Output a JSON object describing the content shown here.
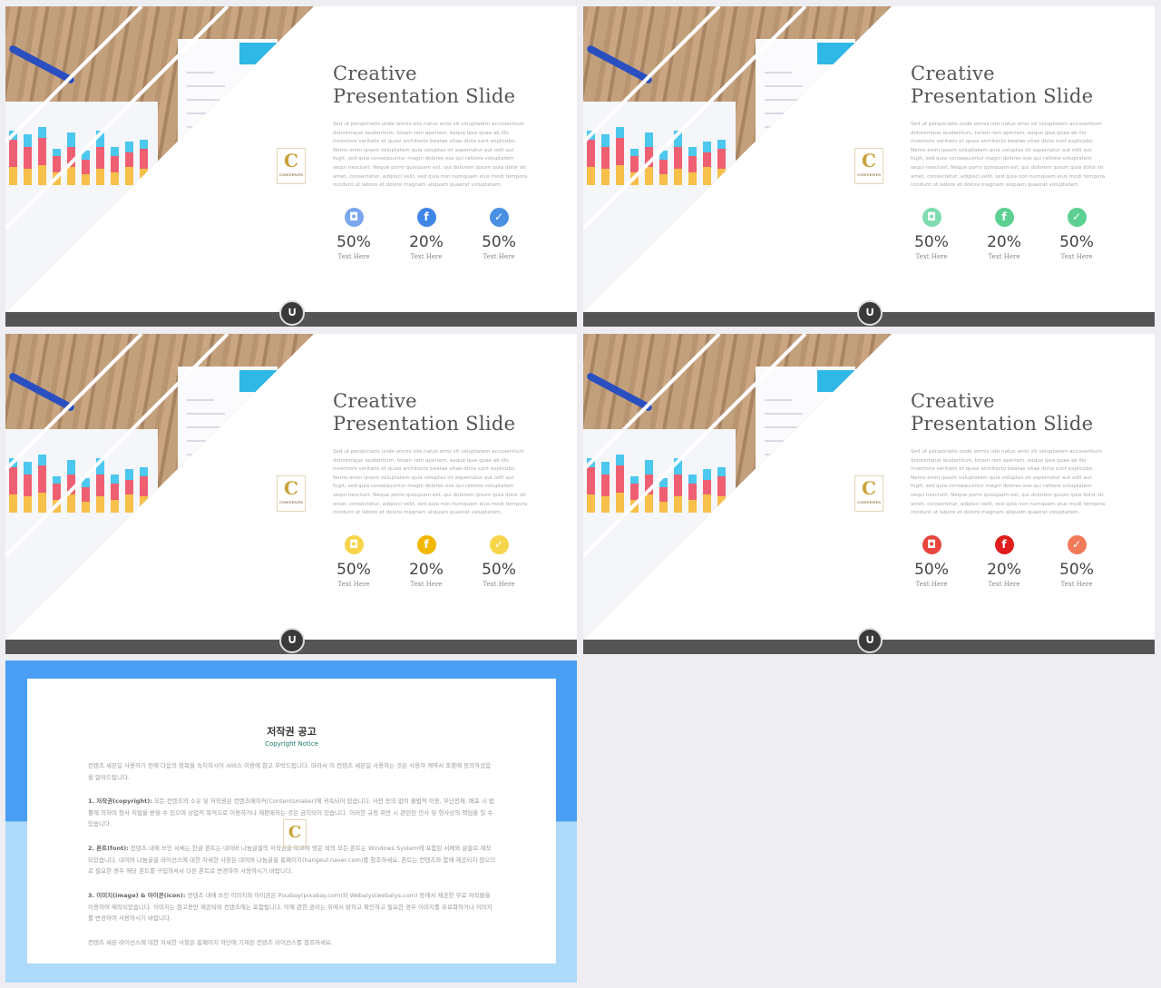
{
  "slides": [
    {
      "title_line1": "Creative",
      "title_line2": "Presentation Slide",
      "body": "Sed ut perspiciatis unde omnis iste natus error sit voluptatem accusantium doloremque laudantium, totam rem aperiam, eaque ipsa quae ab illo inventore veritatis et quasi architecto beatae vitae dicta sunt explicabo. Nemo enim ipsam voluptatem quia voluptas sit aspernatur aut odit aut fugit, sed quia consequuntur magni dolores eos qui ratione voluptatem sequi nesciunt. Neque porro quisquam est, qui dolorem ipsum quia dolor sit amet, consectetur, adipisci velit, sed quia non numquam eius modi tempora incidunt ut labore et dolore magnam aliquam quaerat voluptatem.",
      "logo": "C",
      "logo_sub": "CONTENTS",
      "stats": [
        {
          "icon": "instagram-icon",
          "value": "50%",
          "label": "Text  Here",
          "color": "#7aa6ee"
        },
        {
          "icon": "facebook-icon",
          "value": "20%",
          "label": "Text  Here",
          "color": "#3f86e6"
        },
        {
          "icon": "twitter-icon",
          "value": "50%",
          "label": "Text  Here",
          "color": "#4a90e2"
        }
      ]
    },
    {
      "title_line1": "Creative",
      "title_line2": "Presentation Slide",
      "body": "Sed ut perspiciatis unde omnis iste natus error sit voluptatem accusantium doloremque laudantium, totam rem aperiam, eaque ipsa quae ab illo inventore veritatis et quasi architecto beatae vitae dicta sunt explicabo. Nemo enim ipsam voluptatem quia voluptas sit aspernatur aut odit aut fugit, sed quia consequuntur magni dolores eos qui ratione voluptatem sequi nesciunt. Neque porro quisquam est, qui dolorem ipsum quia dolor sit amet, consectetur, adipisci velit, sed quia non numquam eius modi tempora incidunt ut labore et dolore magnam aliquam quaerat voluptatem.",
      "logo": "C",
      "logo_sub": "CONTENTS",
      "stats": [
        {
          "icon": "instagram-icon",
          "value": "50%",
          "label": "Text  Here",
          "color": "#7fdcb0"
        },
        {
          "icon": "facebook-icon",
          "value": "20%",
          "label": "Text  Here",
          "color": "#5ccf92"
        },
        {
          "icon": "twitter-icon",
          "value": "50%",
          "label": "Text  Here",
          "color": "#5ccf92"
        }
      ]
    },
    {
      "title_line1": "Creative",
      "title_line2": "Presentation Slide",
      "body": "Sed ut perspiciatis unde omnis iste natus error sit voluptatem accusantium doloremque laudantium, totam rem aperiam, eaque ipsa quae ab illo inventore veritatis et quasi architecto beatae vitae dicta sunt explicabo. Nemo enim ipsam voluptatem quia voluptas sit aspernatur aut odit aut fugit, sed quia consequuntur magni dolores eos qui ratione voluptatem sequi nesciunt. Neque porro quisquam est, qui dolorem ipsum quia dolor sit amet, consectetur, adipisci velit, sed quia non numquam eius modi tempora incidunt ut labore et dolore magnam aliquam quaerat voluptatem.",
      "logo": "C",
      "logo_sub": "CONTENTS",
      "stats": [
        {
          "icon": "instagram-icon",
          "value": "50%",
          "label": "Text  Here",
          "color": "#f7d54a"
        },
        {
          "icon": "facebook-icon",
          "value": "20%",
          "label": "Text  Here",
          "color": "#f2b800"
        },
        {
          "icon": "twitter-icon",
          "value": "50%",
          "label": "Text  Here",
          "color": "#f7d54a"
        }
      ]
    },
    {
      "title_line1": "Creative",
      "title_line2": "Presentation Slide",
      "body": "Sed ut perspiciatis unde omnis iste natus error sit voluptatem accusantium doloremque laudantium, totam rem aperiam, eaque ipsa quae ab illo inventore veritatis et quasi architecto beatae vitae dicta sunt explicabo. Nemo enim ipsam voluptatem quia voluptas sit aspernatur aut odit aut fugit, sed quia consequuntur magni dolores eos qui ratione voluptatem sequi nesciunt. Neque porro quisquam est, qui dolorem ipsum quia dolor sit amet, consectetur, adipisci velit, sed quia non numquam eius modi tempora incidunt ut labore et dolore magnam aliquam quaerat voluptatem.",
      "logo": "C",
      "logo_sub": "CONTENTS",
      "stats": [
        {
          "icon": "instagram-icon",
          "value": "50%",
          "label": "Text  Here",
          "color": "#e8453c"
        },
        {
          "icon": "facebook-icon",
          "value": "20%",
          "label": "Text  Here",
          "color": "#e01e1e"
        },
        {
          "icon": "twitter-icon",
          "value": "50%",
          "label": "Text  Here",
          "color": "#f07a5a"
        }
      ]
    }
  ],
  "copyright": {
    "title": "저작권 공고",
    "subtitle": "Copyright Notice",
    "intro": "컨텐츠 세븐일 사용하기 전에 다음의 항목을 숙지하시어 서비스 이용에 참고 부탁드립니다. 따라서 이 컨텐츠 세븐일 사용하는 것은 사용자 계약서 조항에 동의하셨음을 알려드립니다.",
    "items": [
      {
        "head": "1. 저작권(copyright):",
        "text": " 모든 컨텐츠의 소유 및 저작권은 컨텐츠메이커(Contentsmaker)에 귀속되어 있습니다. 사전 동의 없이 불법적 이용, 무단전재, 배포 시 법률에 의하여 형사 처벌을 받을 수 있으며 상업적 목적으로 이용하거나 재판매하는 것은 금지되어 있습니다. 이러한 규정 위반 시 관련된 민사 및 형사상의 책임을 질 수 있습니다."
      },
      {
        "head": "2. 폰트(font):",
        "text": " 컨텐츠 내에 쓰인 서체는 한글 폰트는 네이버 나눔글꼴의 저작권을 따르며 영문 외의 모든 폰트는 Windows System에 포함된 서체와 글꼴로 제작되었습니다. 네이버 나눔글꼴 라이선스에 대한 자세한 사항은 네이버 나눔글꼴 홈페이지(hangeul.naver.com)를 참조하세요. 폰트는 컨텐츠와 함께 제공되지 않으므로 필요한 경우 해당 폰트를 구입하셔서 다른 폰트로 변경하여 사용하시기 바랍니다."
      },
      {
        "head": "3. 이미지(image) & 아이콘(icon):",
        "text": " 컨텐츠 내에 쓰인 이미지와 아이콘은 Pixabay(pixabay.com)와 Webalys(webalys.com) 등에서 제공한 무료 저작물을 이용하여 제작되었습니다. 이미지는 참고용만 제공되며 컨텐츠에는 포함됩니다. 이에 관한 권리는 위에서 밝히고 확인하고 필요한 경우 이미지를 유료화하거나 이미지를 변경하여 사용하시기 바랍니다."
      }
    ],
    "outro": "컨텐츠 세븐 라이선스에 대한 자세한 사항은 홈페이지 하단에 기재된 컨텐츠 라이선스를 참조하세요.",
    "watermark": "C"
  },
  "colors": {
    "footer_bar": "#555555",
    "frame_top": "#4a9ff5",
    "frame_bottom": "#aedafb"
  }
}
